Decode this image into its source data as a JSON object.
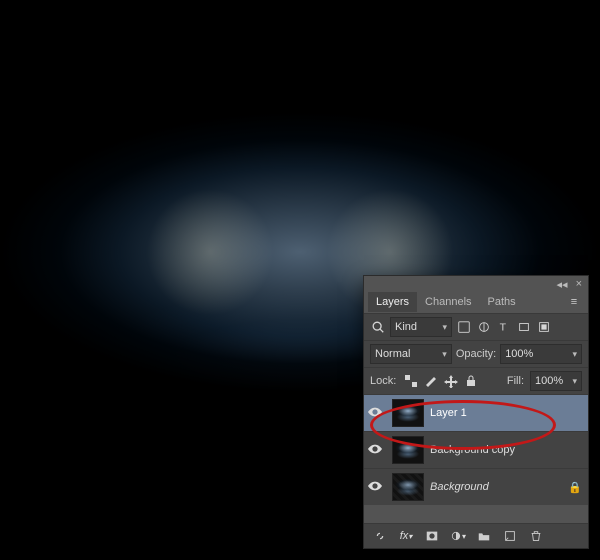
{
  "panel": {
    "tabs": [
      "Layers",
      "Channels",
      "Paths"
    ],
    "activeTab": 0,
    "filterLabel": "Kind",
    "blend": {
      "mode": "Normal",
      "opacityLabel": "Opacity:",
      "opacity": "100%"
    },
    "lock": {
      "label": "Lock:",
      "fillLabel": "Fill:",
      "fill": "100%"
    },
    "layers": [
      {
        "name": "Layer 1",
        "visible": true,
        "selected": true,
        "italic": false,
        "locked": false,
        "thumb": "jelly"
      },
      {
        "name": "Background copy",
        "visible": true,
        "selected": false,
        "italic": false,
        "locked": false,
        "thumb": "jelly"
      },
      {
        "name": "Background",
        "visible": true,
        "selected": false,
        "italic": true,
        "locked": true,
        "thumb": "bg"
      }
    ]
  },
  "colors": {
    "highlight": "#c21818",
    "panelBg": "#535353",
    "panelInner": "#434343",
    "selected": "#6b7d96"
  }
}
